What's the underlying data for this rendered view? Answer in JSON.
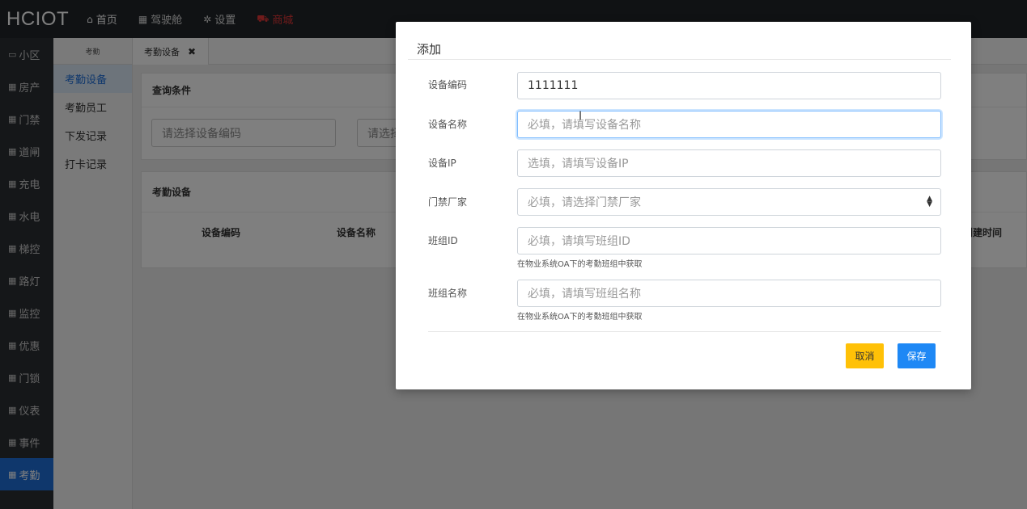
{
  "topbar": {
    "logo": "HCIOT",
    "nav": [
      {
        "icon": "home-icon",
        "glyph": "⌂",
        "label": "首页"
      },
      {
        "icon": "cockpit-icon",
        "glyph": "▦",
        "label": "驾驶舱"
      },
      {
        "icon": "gear-icon",
        "glyph": "✲",
        "label": "设置"
      },
      {
        "icon": "cart-icon",
        "glyph": "⛟",
        "label": "商城"
      }
    ]
  },
  "sidebar": {
    "items": [
      {
        "label": "小区"
      },
      {
        "label": "房产"
      },
      {
        "label": "门禁"
      },
      {
        "label": "道闸"
      },
      {
        "label": "充电"
      },
      {
        "label": "水电"
      },
      {
        "label": "梯控"
      },
      {
        "label": "路灯"
      },
      {
        "label": "监控"
      },
      {
        "label": "优惠"
      },
      {
        "label": "门锁"
      },
      {
        "label": "仪表"
      },
      {
        "label": "事件"
      },
      {
        "label": "考勤"
      }
    ],
    "active_index": 13
  },
  "submenu": {
    "header": "考勤",
    "items": [
      {
        "label": "考勤设备"
      },
      {
        "label": "考勤员工"
      },
      {
        "label": "下发记录"
      },
      {
        "label": "打卡记录"
      }
    ]
  },
  "tabs": {
    "active": {
      "label": "考勤设备",
      "close": "✖"
    }
  },
  "query": {
    "title": "查询条件",
    "input1_placeholder": "请选择设备编码",
    "input2_placeholder": "请选择"
  },
  "list": {
    "title": "考勤设备",
    "columns": [
      "设备编码",
      "设备名称",
      "创建时间"
    ]
  },
  "modal": {
    "title": "添加",
    "fields": [
      {
        "label": "设备编码",
        "value": "1111111",
        "placeholder": ""
      },
      {
        "label": "设备名称",
        "value": "",
        "placeholder": "必填，请填写设备名称"
      },
      {
        "label": "设备IP",
        "value": "",
        "placeholder": "选填，请填写设备IP"
      },
      {
        "label": "门禁厂家",
        "value": "",
        "placeholder": "必填，请选择门禁厂家"
      },
      {
        "label": "班组ID",
        "value": "",
        "placeholder": "必填，请填写班组ID",
        "help": "在物业系统OA下的考勤班组中获取"
      },
      {
        "label": "班组名称",
        "value": "",
        "placeholder": "必填，请填写班组名称",
        "help": "在物业系统OA下的考勤班组中获取"
      }
    ],
    "cancel_label": "取消",
    "save_label": "保存"
  },
  "colors": {
    "topbar": "#212529",
    "sidebar": "#2b2f33",
    "active_blue": "#1e6fd9",
    "cancel": "#ffc107",
    "save": "#1e88f5",
    "shop_red": "#e23636"
  }
}
